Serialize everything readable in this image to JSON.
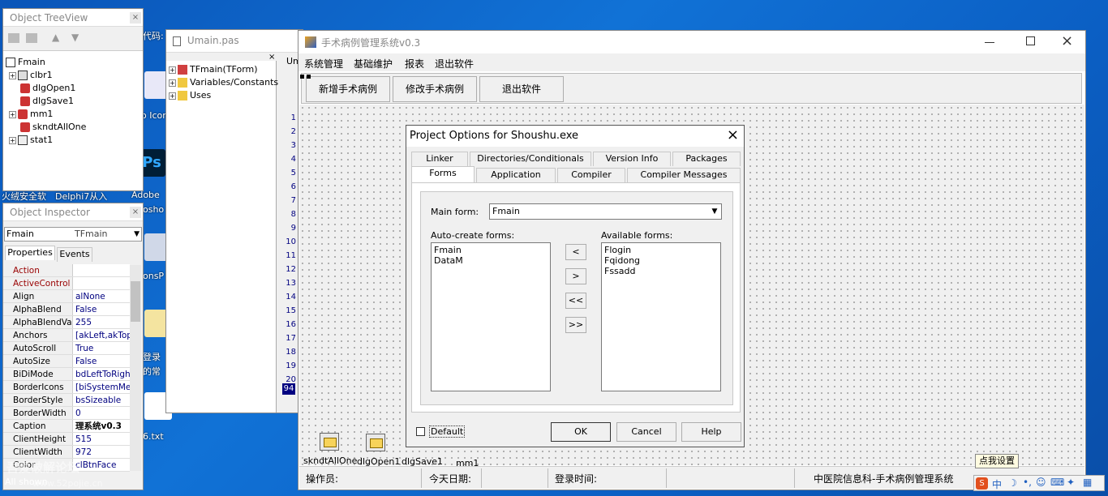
{
  "desktop": {
    "labels": [
      "代码:",
      "o Icon",
      "火绒安全软",
      "Delphi7从入",
      "Adobe",
      "osho",
      "onsP",
      "登录",
      "的常",
      "6.txt"
    ],
    "watermark": "吾爱破解论坛",
    "watermark_url": "www.52pojie.cn"
  },
  "treeview": {
    "title": "Object TreeView",
    "items": [
      "Fmain",
      "clbr1",
      "dlgOpen1",
      "dlgSave1",
      "mm1",
      "skndtAllOne",
      "stat1"
    ]
  },
  "inspector": {
    "title": "Object Inspector",
    "object_name": "Fmain",
    "object_type": "TFmain",
    "tab_properties": "Properties",
    "tab_events": "Events",
    "props": [
      {
        "k": "Action",
        "v": ""
      },
      {
        "k": "ActiveControl",
        "v": ""
      },
      {
        "k": "Align",
        "v": "alNone"
      },
      {
        "k": "AlphaBlend",
        "v": "False"
      },
      {
        "k": "AlphaBlendValu",
        "v": "255"
      },
      {
        "k": "Anchors",
        "v": "[akLeft,akTop"
      },
      {
        "k": "AutoScroll",
        "v": "True"
      },
      {
        "k": "AutoSize",
        "v": "False"
      },
      {
        "k": "BiDiMode",
        "v": "bdLeftToRight"
      },
      {
        "k": "BorderIcons",
        "v": "[biSystemMen"
      },
      {
        "k": "BorderStyle",
        "v": "bsSizeable"
      },
      {
        "k": "BorderWidth",
        "v": "0"
      },
      {
        "k": "Caption",
        "v": "理系统v0.3"
      },
      {
        "k": "ClientHeight",
        "v": "515"
      },
      {
        "k": "ClientWidth",
        "v": "972"
      },
      {
        "k": "Color",
        "v": "clBtnFace"
      }
    ],
    "footer": "All shown"
  },
  "editor": {
    "tab": "Umain.pas",
    "tree": [
      "TFmain(TForm)",
      "Variables/Constants",
      "Uses"
    ],
    "line_numbers": [
      "1",
      "2",
      "3",
      "4",
      "5",
      "6",
      "7",
      "8",
      "9",
      "10",
      "11",
      "12",
      "13",
      "14",
      "15",
      "16",
      "17",
      "18",
      "19",
      "20"
    ],
    "current_line": "94",
    "side_label": "Um"
  },
  "form": {
    "title": "手术病例管理系统v0.3",
    "menu": [
      "系统管理",
      "基础维护",
      "报表",
      "退出软件"
    ],
    "toolbar_buttons": [
      "新增手术病例",
      "修改手术病例",
      "退出软件"
    ],
    "components": [
      "skndtAllOne",
      "dlgOpen1",
      "dlgSave1",
      "mm1"
    ],
    "status": {
      "operator": "操作员:",
      "today": "今天日期:",
      "login_time": "登录时间:",
      "org": "中医院信息科-手术病例管理系统"
    }
  },
  "dialog": {
    "title": "Project Options for Shoushu.exe",
    "tabs_row1": [
      "Linker",
      "Directories/Conditionals",
      "Version Info",
      "Packages"
    ],
    "tabs_row2": [
      "Forms",
      "Application",
      "Compiler",
      "Compiler Messages"
    ],
    "main_form_label": "Main form:",
    "main_form_value": "Fmain",
    "auto_create_label": "Auto-create forms:",
    "auto_create": [
      "Fmain",
      "DataM"
    ],
    "available_label": "Available forms:",
    "available": [
      "Flogin",
      "Fqidong",
      "Fssadd"
    ],
    "move_buttons": [
      "<",
      ">",
      "<<",
      ">>"
    ],
    "default_label": "Default",
    "ok": "OK",
    "cancel": "Cancel",
    "help": "Help"
  },
  "ime": {
    "tooltip": "点我设置",
    "lang": "中"
  }
}
